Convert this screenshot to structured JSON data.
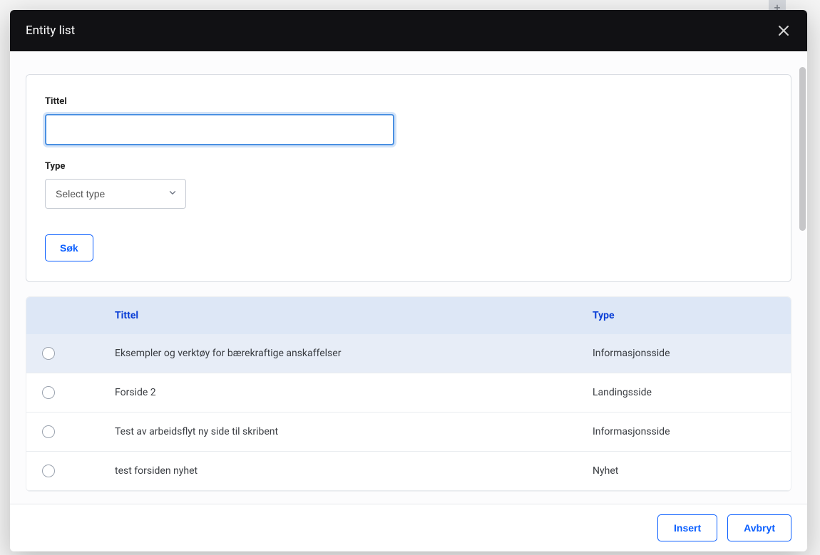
{
  "modal": {
    "title": "Entity list"
  },
  "filters": {
    "title_label": "Tittel",
    "title_value": "",
    "type_label": "Type",
    "type_placeholder": "Select type",
    "search_button": "Søk"
  },
  "table": {
    "header_title": "Tittel",
    "header_type": "Type",
    "rows": [
      {
        "title": "Eksempler og verktøy for bærekraftige anskaffelser",
        "type": "Informasjonsside"
      },
      {
        "title": "Forside 2",
        "type": "Landingsside"
      },
      {
        "title": "Test av arbeidsflyt ny side til skribent",
        "type": "Informasjonsside"
      },
      {
        "title": "test forsiden nyhet",
        "type": "Nyhet"
      }
    ]
  },
  "footer": {
    "insert": "Insert",
    "cancel": "Avbryt"
  }
}
